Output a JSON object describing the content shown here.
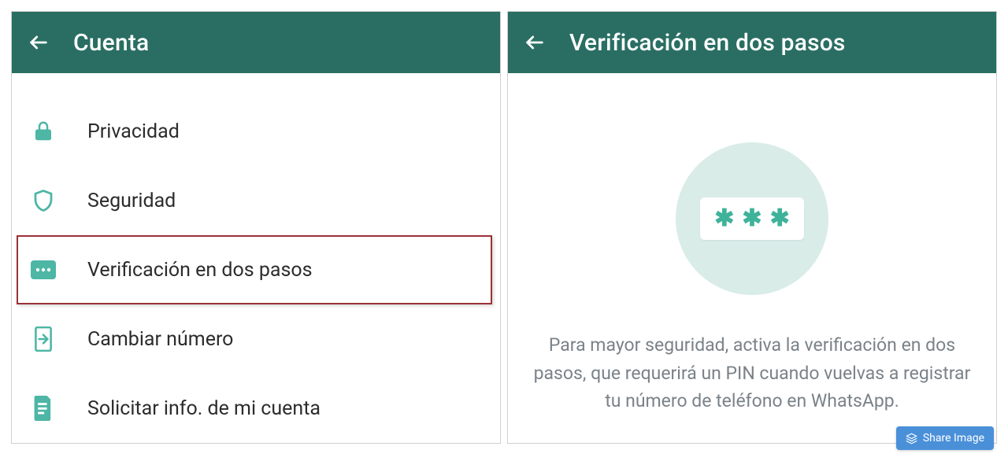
{
  "left": {
    "header": {
      "title": "Cuenta"
    },
    "menu": [
      {
        "icon": "lock-icon",
        "label": "Privacidad"
      },
      {
        "icon": "shield-icon",
        "label": "Seguridad"
      },
      {
        "icon": "pin-icon",
        "label": "Verificación en dos pasos",
        "highlighted": true
      },
      {
        "icon": "sim-icon",
        "label": "Cambiar número"
      },
      {
        "icon": "doc-icon",
        "label": "Solicitar info. de mi cuenta"
      }
    ]
  },
  "right": {
    "header": {
      "title": "Verificación en dos pasos"
    },
    "illustration": {
      "asterisks": "***"
    },
    "description": "Para mayor seguridad, activa la verificación en dos pasos, que requerirá un PIN cuando vuelvas a registrar tu número de teléfono en WhatsApp."
  },
  "overlay": {
    "share_label": "Share Image"
  },
  "colors": {
    "header_bg": "#2a6e63",
    "icon": "#4db6a5",
    "highlight": "#9a3238",
    "text_muted": "#7a8288"
  }
}
